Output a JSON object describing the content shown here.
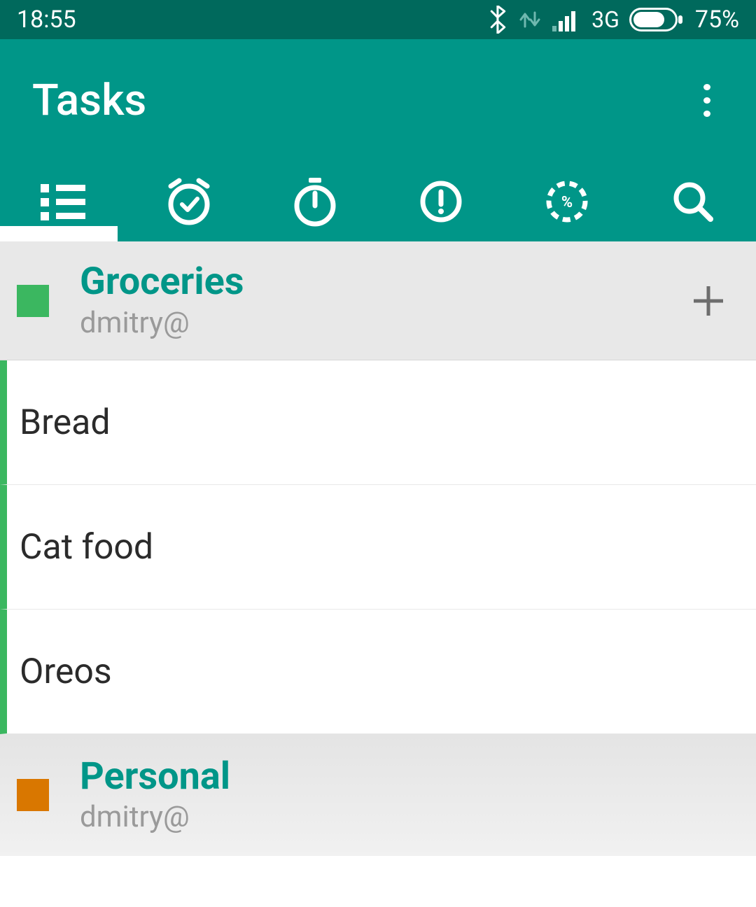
{
  "status": {
    "time": "18:55",
    "network": "3G",
    "battery_pct": "75%"
  },
  "appbar": {
    "title": "Tasks"
  },
  "lists": [
    {
      "title": "Groceries",
      "account": "dmitry@",
      "color": "#3bb760",
      "items": [
        {
          "title": "Bread"
        },
        {
          "title": "Cat food"
        },
        {
          "title": "Oreos"
        }
      ]
    },
    {
      "title": "Personal",
      "account": "dmitry@",
      "color": "#d97700"
    }
  ]
}
